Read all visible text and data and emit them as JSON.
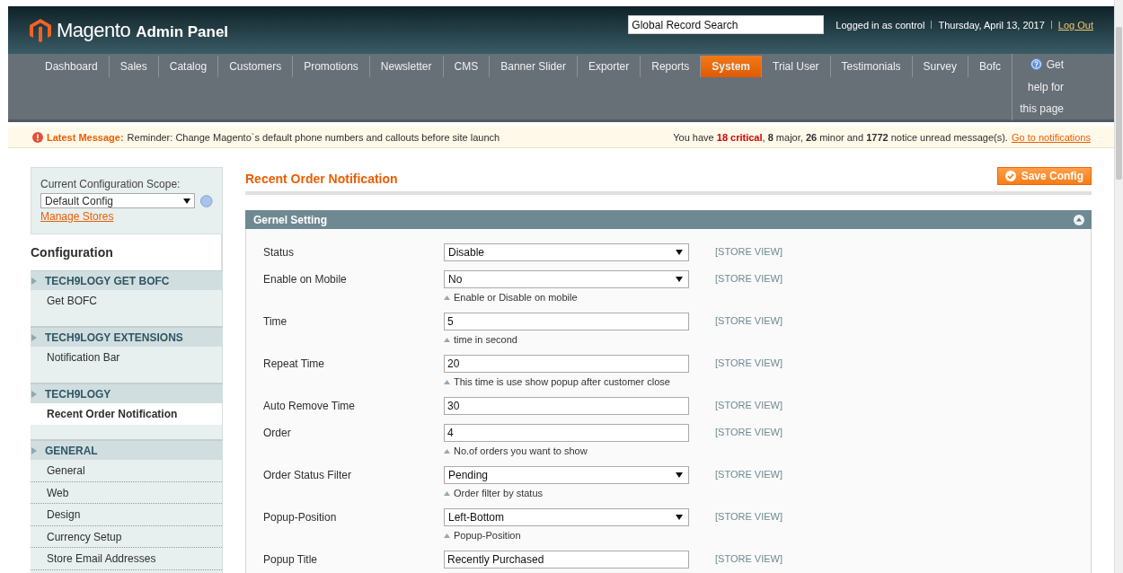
{
  "header": {
    "logo_name": "Magento",
    "logo_suffix": "Admin Panel",
    "search": {
      "value": "Global Record Search"
    },
    "user": "Logged in as control",
    "date": "Thursday, April 13, 2017",
    "logout": "Log Out"
  },
  "nav": {
    "items": [
      {
        "label": "Dashboard",
        "selected": false
      },
      {
        "label": "Sales",
        "selected": false
      },
      {
        "label": "Catalog",
        "selected": false
      },
      {
        "label": "Customers",
        "selected": false
      },
      {
        "label": "Promotions",
        "selected": false
      },
      {
        "label": "Newsletter",
        "selected": false
      },
      {
        "label": "CMS",
        "selected": false
      },
      {
        "label": "Banner Slider",
        "selected": false
      },
      {
        "label": "Exporter",
        "selected": false
      },
      {
        "label": "Reports",
        "selected": false
      },
      {
        "label": "System",
        "selected": true
      },
      {
        "label": "Trial User",
        "selected": false
      },
      {
        "label": "Testimonials",
        "selected": false
      },
      {
        "label": "Survey",
        "selected": false
      },
      {
        "label": "Bofc",
        "selected": false
      }
    ],
    "help": "Get help for this page"
  },
  "message": {
    "label": "Latest Message:",
    "text": "Reminder: Change Magento`s default phone numbers and callouts before site launch",
    "summary": "You have **18 critical**, **8** major, **26** minor and **1772** notice unread message(s).",
    "link": "Go to notifications"
  },
  "sidebar": {
    "scope_label": "Current Configuration Scope:",
    "scope_value": "Default Config",
    "manage_link": "Manage Stores",
    "heading": "Configuration",
    "sections": [
      {
        "title": "TECH9LOGY GET BOFC",
        "items": [
          {
            "label": "Get BOFC",
            "selected": false
          }
        ]
      },
      {
        "title": "TECH9LOGY EXTENSIONS",
        "items": [
          {
            "label": "Notification Bar",
            "selected": false
          }
        ]
      },
      {
        "title": "TECH9LOGY",
        "items": [
          {
            "label": "Recent Order Notification",
            "selected": true
          }
        ]
      },
      {
        "title": "GENERAL",
        "items": [
          {
            "label": "General",
            "selected": false
          },
          {
            "label": "Web",
            "selected": false
          },
          {
            "label": "Design",
            "selected": false
          },
          {
            "label": "Currency Setup",
            "selected": false
          },
          {
            "label": "Store Email Addresses",
            "selected": false
          }
        ]
      }
    ]
  },
  "main": {
    "title": "Recent Order Notification",
    "save_button": "Save Config",
    "fieldset": {
      "title": "Gernel Setting",
      "expanded": true,
      "rows": [
        {
          "label": "Status",
          "kind": "select",
          "value": "Disable",
          "scope": "[STORE VIEW]"
        },
        {
          "label": "Enable on Mobile",
          "kind": "select",
          "value": "No",
          "comment": "Enable or Disable on mobile",
          "scope": "[STORE VIEW]"
        },
        {
          "label": "Time",
          "kind": "text",
          "value": "5",
          "comment": "time in second",
          "scope": "[STORE VIEW]"
        },
        {
          "label": "Repeat Time",
          "kind": "text",
          "value": "20",
          "comment": "This time is use show popup after customer close",
          "scope": "[STORE VIEW]"
        },
        {
          "label": "Auto Remove Time",
          "kind": "text",
          "value": "30",
          "scope": "[STORE VIEW]"
        },
        {
          "label": "Order",
          "kind": "text",
          "value": "4",
          "comment": "No.of orders you want to show",
          "scope": "[STORE VIEW]"
        },
        {
          "label": "Order Status Filter",
          "kind": "select",
          "value": "Pending",
          "comment": "Order filter by status",
          "scope": "[STORE VIEW]"
        },
        {
          "label": "Popup-Position",
          "kind": "select",
          "value": "Left-Bottom",
          "comment": "Popup-Position",
          "scope": "[STORE VIEW]"
        },
        {
          "label": "Popup Title",
          "kind": "text",
          "value": "Recently Purchased",
          "scope": "[STORE VIEW]"
        }
      ]
    }
  }
}
